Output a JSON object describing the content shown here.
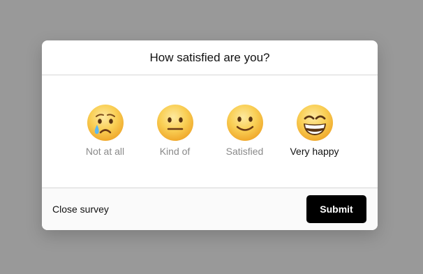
{
  "survey": {
    "title": "How satisfied are you?",
    "options": [
      {
        "label": "Not at all",
        "icon": "crying-face-icon",
        "selected": false
      },
      {
        "label": "Kind of",
        "icon": "neutral-face-icon",
        "selected": false
      },
      {
        "label": "Satisfied",
        "icon": "slightly-smiling-face-icon",
        "selected": false
      },
      {
        "label": "Very happy",
        "icon": "grinning-face-icon",
        "selected": true
      }
    ],
    "close_label": "Close survey",
    "submit_label": "Submit"
  },
  "colors": {
    "backdrop": "#999999",
    "submit_bg": "#000000",
    "face_yellow": "#f8c23a"
  }
}
